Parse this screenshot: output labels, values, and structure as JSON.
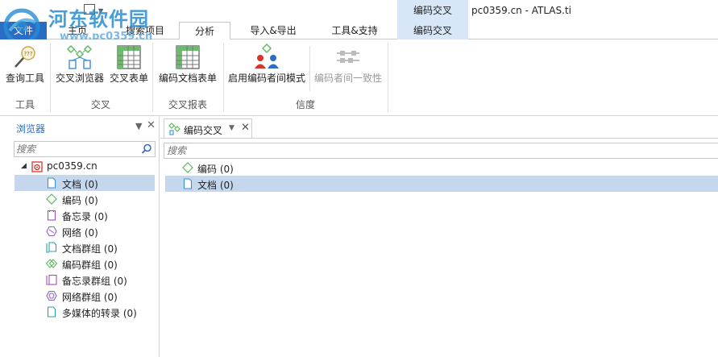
{
  "titlebar": {
    "context_title": "编码交叉",
    "app_title": "pc0359.cn - ATLAS.ti"
  },
  "watermark": {
    "line1": "河东软件园",
    "line2": "www.pc0359.cn"
  },
  "tabs": {
    "file": "文件",
    "home": "主页",
    "query": "搜索项目",
    "analysis": "分析",
    "import_export": "导入&导出",
    "tools_support": "工具&支持",
    "context": "编码交叉"
  },
  "ribbon": {
    "groups": {
      "tools": "工具",
      "cross": "交叉",
      "cross_report": "交叉报表",
      "reliability": "信度"
    },
    "buttons": {
      "query_tool": "查询工具",
      "cross_browser": "交叉浏览器",
      "cross_table": "交叉表单",
      "code_doc_table": "编码文档表单",
      "inter_coder_mode": "启用编码者间模式",
      "inter_coder_agreement": "编码者间一致性"
    }
  },
  "browser": {
    "title": "浏览器",
    "search_placeholder": "搜索",
    "root": "pc0359.cn",
    "items": [
      {
        "label": "文档 (0)",
        "icon": "document-icon"
      },
      {
        "label": "编码 (0)",
        "icon": "code-diamond-icon"
      },
      {
        "label": "备忘录 (0)",
        "icon": "memo-icon"
      },
      {
        "label": "网络 (0)",
        "icon": "network-icon"
      },
      {
        "label": "文档群组 (0)",
        "icon": "document-group-icon"
      },
      {
        "label": "编码群组 (0)",
        "icon": "code-group-icon"
      },
      {
        "label": "备忘录群组 (0)",
        "icon": "memo-group-icon"
      },
      {
        "label": "网络群组 (0)",
        "icon": "network-group-icon"
      },
      {
        "label": "多媒体的转录 (0)",
        "icon": "transcript-icon"
      }
    ]
  },
  "main": {
    "tab_label": "编码交叉",
    "search_placeholder": "搜索",
    "rows": [
      {
        "label": "编码 (0)",
        "icon": "code-diamond-icon"
      },
      {
        "label": "文档 (0)",
        "icon": "document-icon"
      }
    ]
  },
  "colors": {
    "accent": "#2b6cc4",
    "selection": "#c5d7ec",
    "context_tab": "#d7e7f7",
    "code_green": "#5cb85c",
    "doc_blue": "#3a8fd9",
    "memo_purple": "#a04fb8"
  }
}
